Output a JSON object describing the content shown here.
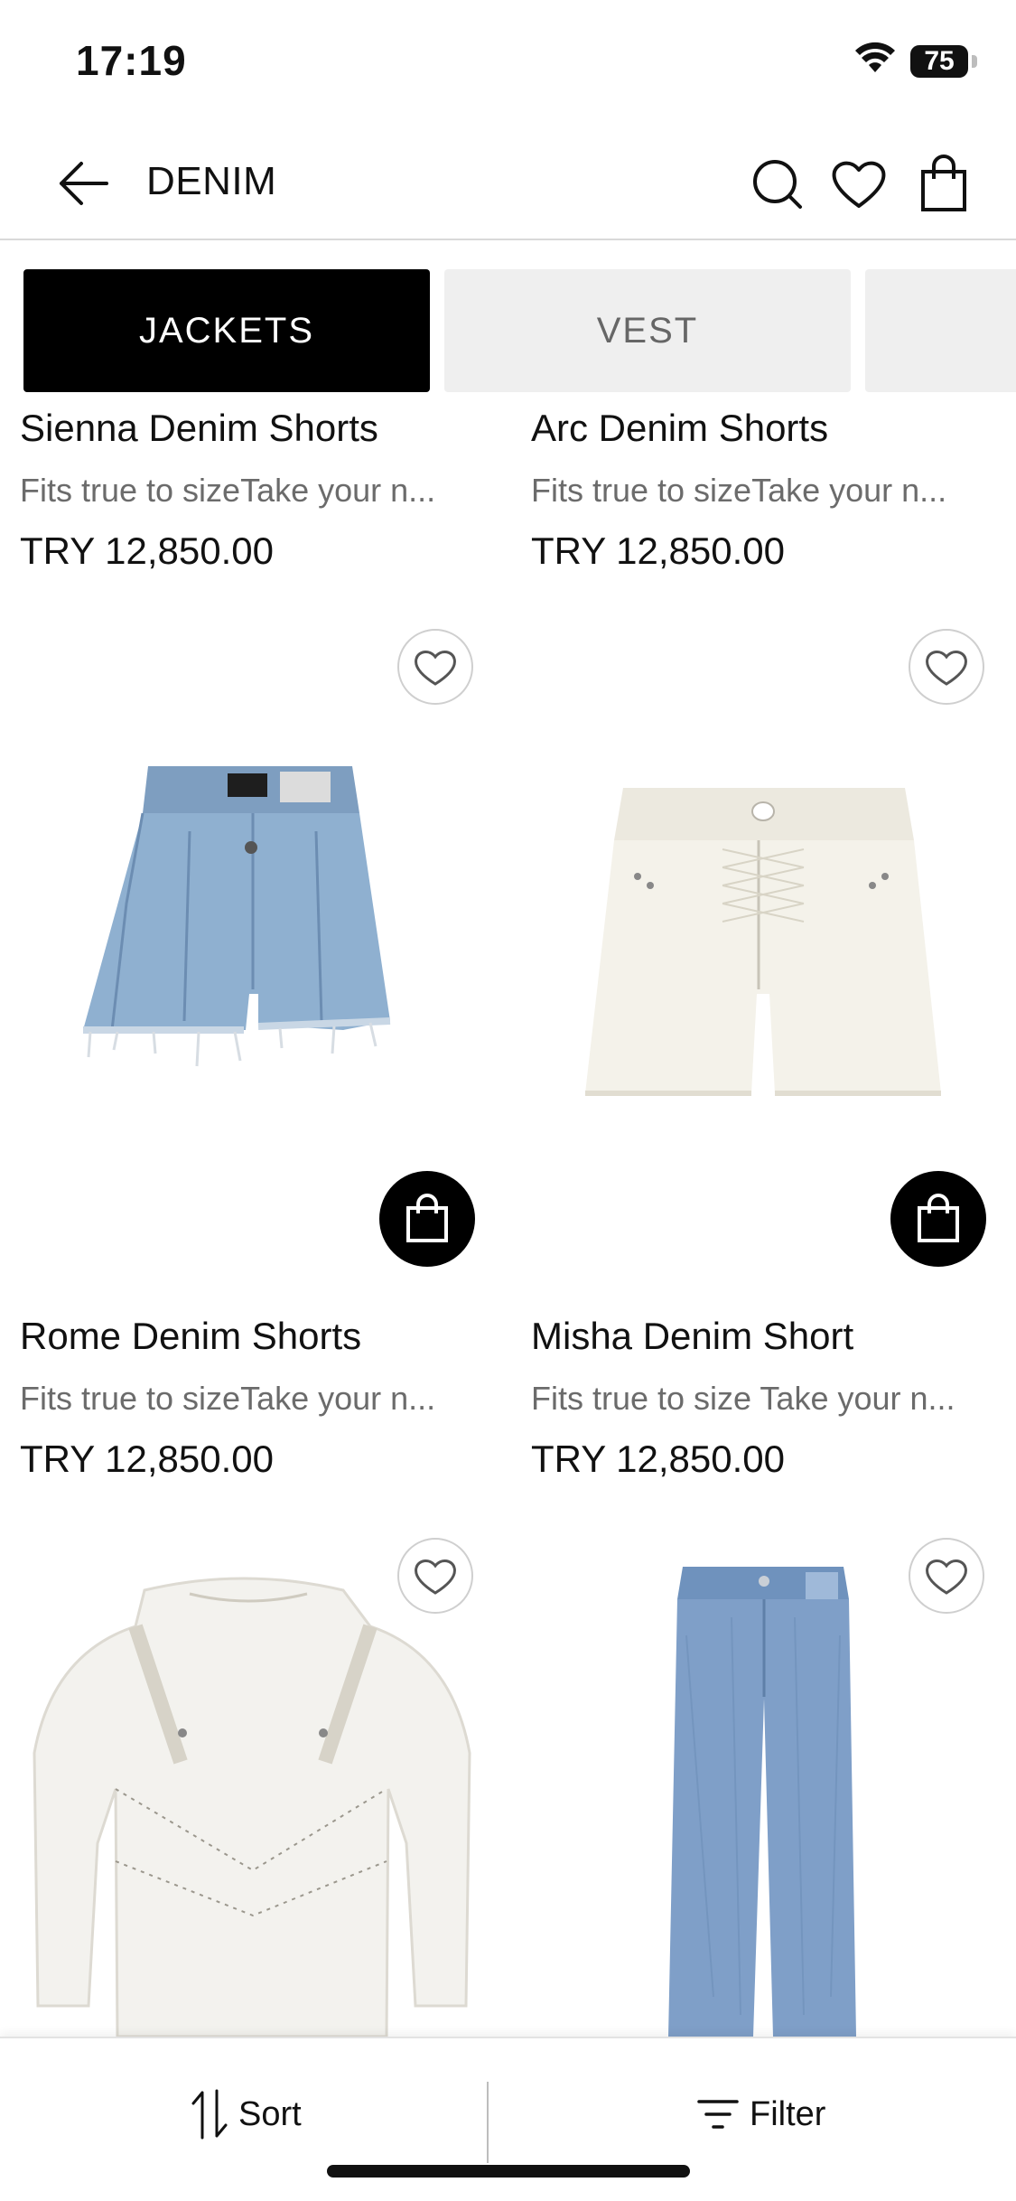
{
  "status": {
    "time": "17:19",
    "battery": "75"
  },
  "header": {
    "title": "DENIM"
  },
  "tabs": [
    {
      "label": "JACKETS",
      "active": true
    },
    {
      "label": "VEST",
      "active": false
    }
  ],
  "products": [
    {
      "name": "Sienna Denim Shorts",
      "description": "Fits true to sizeTake your n...",
      "price": "TRY 12,850.00"
    },
    {
      "name": "Arc Denim Shorts",
      "description": "Fits true to sizeTake your n...",
      "price": "TRY 12,850.00"
    },
    {
      "name": "Rome Denim Shorts",
      "description": "Fits true to sizeTake your n...",
      "price": "TRY 12,850.00"
    },
    {
      "name": "Misha Denim Short",
      "description": "Fits true to size Take your n...",
      "price": "TRY 12,850.00"
    }
  ],
  "bottom_bar": {
    "sort_label": "Sort",
    "filter_label": "Filter"
  },
  "icons": [
    "arrow-left-icon",
    "search-icon",
    "heart-icon",
    "shopping-bag-icon",
    "sort-icon",
    "filter-icon",
    "wifi-icon",
    "battery-icon"
  ],
  "colors": {
    "active_tab": "#000000",
    "inactive_tab": "#efefef",
    "denim_light": "#8fb0d0",
    "cream": "#f4f2ea"
  }
}
